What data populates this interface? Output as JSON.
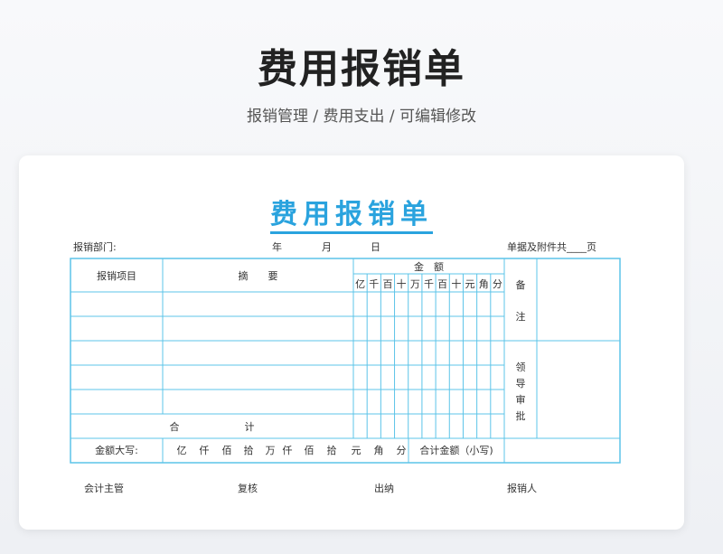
{
  "header": {
    "title": "费用报销单",
    "subtitle": "报销管理 / 费用支出 /  可编辑修改"
  },
  "form": {
    "title": "费用报销单",
    "department_label": "报销部门:",
    "year_label": "年",
    "month_label": "月",
    "day_label": "日",
    "attachments_label": "单据及附件共____页",
    "col_item": "报销项目",
    "col_summary": "摘　　要",
    "col_amount": "金　额",
    "digit_units": [
      "亿",
      "千",
      "百",
      "十",
      "万",
      "千",
      "百",
      "十",
      "元",
      "角",
      "分"
    ],
    "remarks_chars": [
      "备",
      "注"
    ],
    "leader_chars": [
      "领",
      "导",
      "审",
      "批"
    ],
    "total_chars": [
      "合",
      "计"
    ],
    "amount_upper_label": "金额大写:",
    "amount_upper_units": [
      "亿",
      "仟",
      "佰",
      "拾",
      "万",
      "仟",
      "佰",
      "拾",
      "元",
      "角",
      "分"
    ],
    "total_amount_small_label": "合计金额（小写)",
    "footer": {
      "accounting_supervisor": "会计主管",
      "review": "复核",
      "cashier": "出纳",
      "claimant": "报销人"
    }
  },
  "colors": {
    "accent": "#2aa3de",
    "grid": "#5cc4e8"
  }
}
